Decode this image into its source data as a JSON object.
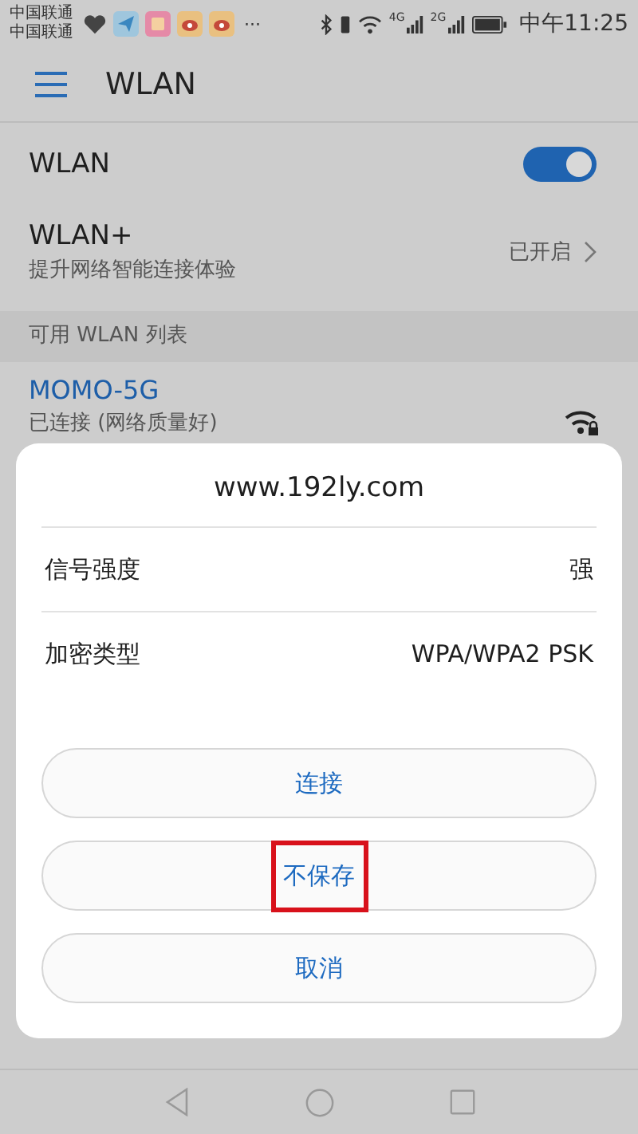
{
  "status_bar": {
    "carriers": [
      "中国联通",
      "中国联通"
    ],
    "more": "···",
    "network_labels": [
      "4G",
      "2G"
    ],
    "time": "中午11:25"
  },
  "app_bar": {
    "title": "WLAN"
  },
  "settings": [
    {
      "kind": "toggle",
      "title": "WLAN",
      "on": true
    },
    {
      "kind": "link",
      "title": "WLAN+",
      "subtitle": "提升网络智能连接体验",
      "value": "已开启"
    }
  ],
  "section_header": "可用 WLAN 列表",
  "networks": [
    {
      "name": "MOMO-5G",
      "status": "已连接 (网络质量好)",
      "secured": true
    }
  ],
  "dialog": {
    "title": "www.192ly.com",
    "rows": [
      {
        "label": "信号强度",
        "value": "强"
      },
      {
        "label": "加密类型",
        "value": "WPA/WPA2 PSK"
      }
    ],
    "buttons": [
      {
        "label": "连接",
        "highlighted": false
      },
      {
        "label": "不保存",
        "highlighted": true
      },
      {
        "label": "取消",
        "highlighted": false
      }
    ]
  }
}
